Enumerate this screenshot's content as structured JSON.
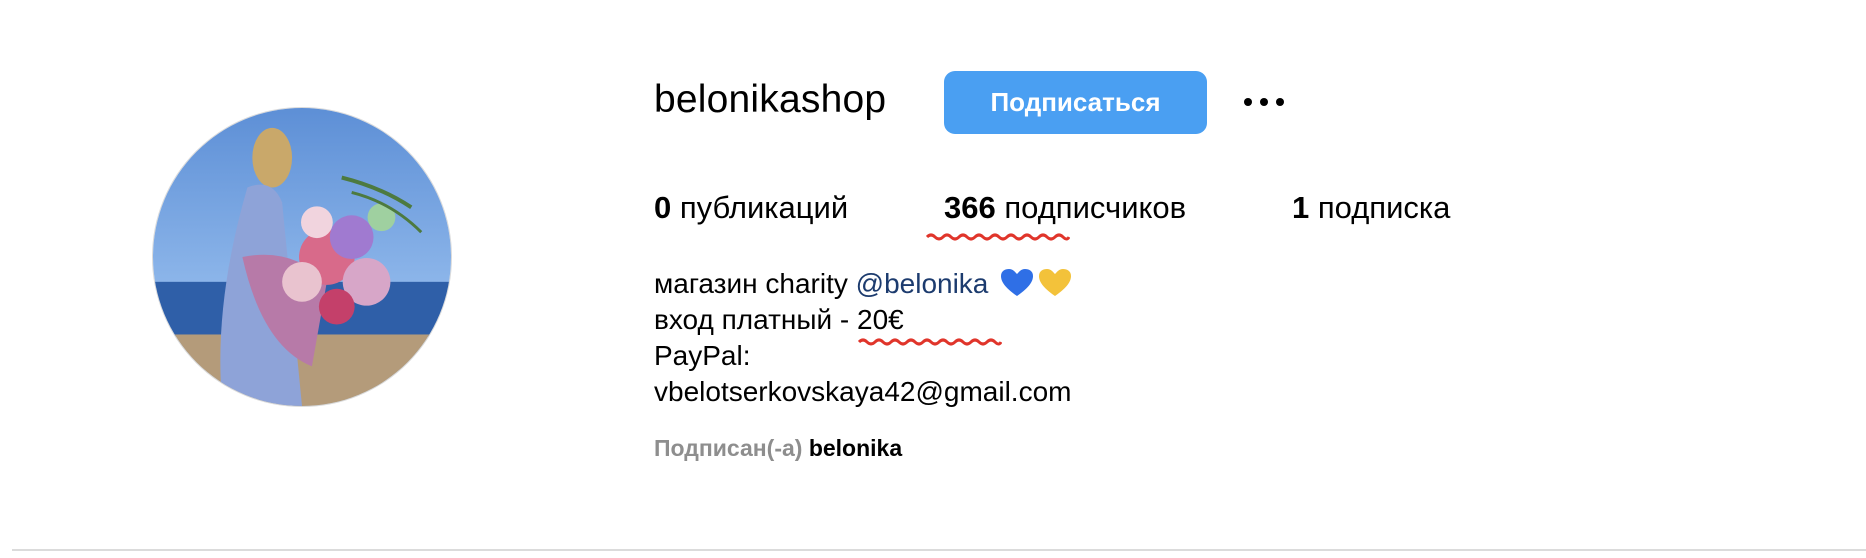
{
  "profile": {
    "username": "belonikashop",
    "follow_label": "Подписаться",
    "more_icon": "more-horizontal-icon"
  },
  "stats": {
    "posts_count": "0",
    "posts_label": "публикаций",
    "followers_count": "366",
    "followers_label": "подписчиков",
    "following_count": "1",
    "following_label": "подписка"
  },
  "bio": {
    "line1_text": "магазин charity ",
    "line1_mention": "@belonika",
    "line1_emojis": [
      "blue-heart-icon",
      "yellow-heart-icon"
    ],
    "line2": "вход платный - 20€",
    "line3": "PayPal:",
    "line4": "vbelotserkovskaya42@gmail.com"
  },
  "followed_by": {
    "label": "Подписан(-а)",
    "user": "belonika"
  },
  "colors": {
    "follow_button": "#4a9ff2",
    "mention": "#1c3b6e",
    "annotation": "#e0352b",
    "muted": "#8e8e8e"
  }
}
